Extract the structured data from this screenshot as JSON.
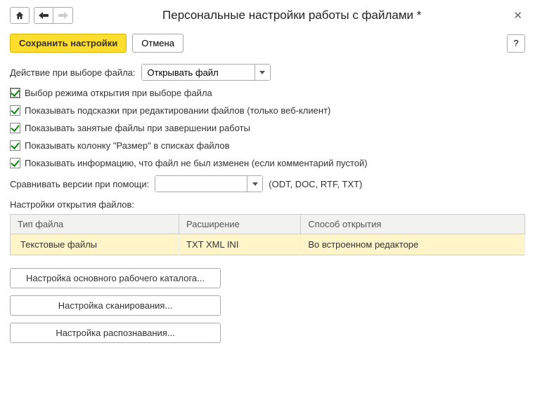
{
  "title": "Персональные настройки работы с файлами *",
  "toolbar": {
    "save_label": "Сохранить настройки",
    "cancel_label": "Отмена",
    "help_label": "?"
  },
  "action_on_select": {
    "label": "Действие при выборе файла:",
    "value": "Открывать файл"
  },
  "checkboxes": [
    {
      "label": "Выбор режима открытия при выборе файла",
      "checked": true,
      "highlight": true
    },
    {
      "label": "Показывать подсказки при редактировании файлов (только веб-клиент)",
      "checked": true
    },
    {
      "label": "Показывать занятые файлы при завершении работы",
      "checked": true
    },
    {
      "label": "Показывать колонку \"Размер\" в списках файлов",
      "checked": true
    },
    {
      "label": "Показывать информацию, что файл не был изменен  (если комментарий пустой)",
      "checked": true
    }
  ],
  "compare": {
    "label": "Сравнивать версии при помощи:",
    "value": "",
    "hint": "(ODT, DOC, RTF, TXT)"
  },
  "table_section_label": "Настройки открытия файлов:",
  "table": {
    "headers": [
      "Тип файла",
      "Расширение",
      "Способ открытия"
    ],
    "rows": [
      {
        "type": "Текстовые файлы",
        "ext": "TXT XML INI",
        "mode": "Во встроенном редакторе",
        "selected": true
      }
    ]
  },
  "wide_buttons": [
    "Настройка основного рабочего каталога...",
    "Настройка сканирования...",
    "Настройка распознавания..."
  ]
}
